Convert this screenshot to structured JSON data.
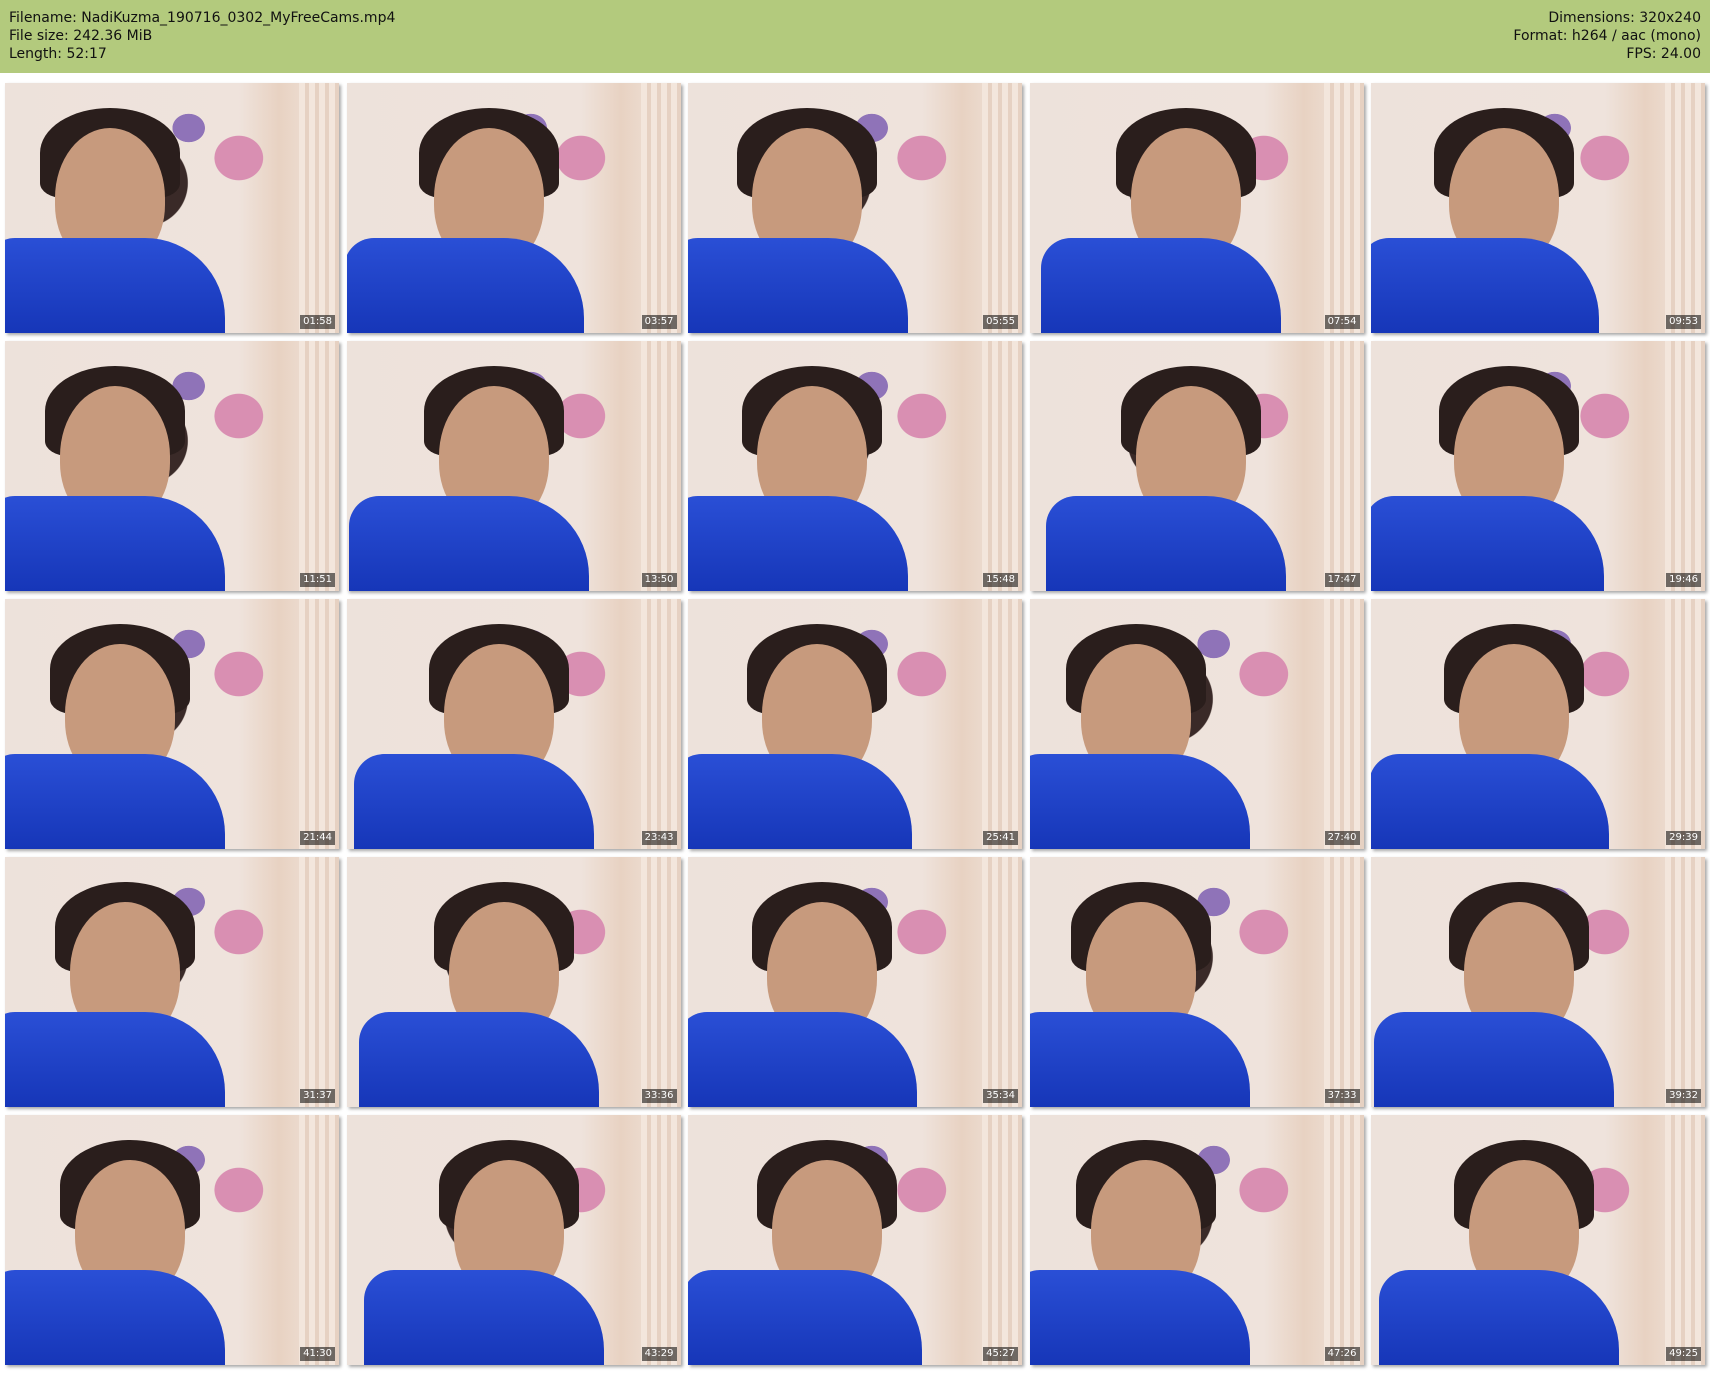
{
  "header": {
    "filename_line": "Filename: NadiKuzma_190716_0302_MyFreeCams.mp4",
    "filesize_line": "File size: 242.36 MiB",
    "length_line": "Length: 52:17",
    "dimensions_line": "Dimensions: 320x240",
    "format_line": "Format: h264 / aac (mono)",
    "fps_line": "FPS: 24.00",
    "background_color": "#b3ca7d"
  },
  "thumbnails": [
    {
      "timestamp": "01:58"
    },
    {
      "timestamp": "03:57"
    },
    {
      "timestamp": "05:55"
    },
    {
      "timestamp": "07:54"
    },
    {
      "timestamp": "09:53"
    },
    {
      "timestamp": "11:51"
    },
    {
      "timestamp": "13:50"
    },
    {
      "timestamp": "15:48"
    },
    {
      "timestamp": "17:47"
    },
    {
      "timestamp": "19:46"
    },
    {
      "timestamp": "21:44"
    },
    {
      "timestamp": "23:43"
    },
    {
      "timestamp": "25:41"
    },
    {
      "timestamp": "27:40"
    },
    {
      "timestamp": "29:39"
    },
    {
      "timestamp": "31:37"
    },
    {
      "timestamp": "33:36"
    },
    {
      "timestamp": "35:34"
    },
    {
      "timestamp": "37:33"
    },
    {
      "timestamp": "39:32"
    },
    {
      "timestamp": "41:30"
    },
    {
      "timestamp": "43:29"
    },
    {
      "timestamp": "45:27"
    },
    {
      "timestamp": "47:26"
    },
    {
      "timestamp": "49:25"
    }
  ]
}
